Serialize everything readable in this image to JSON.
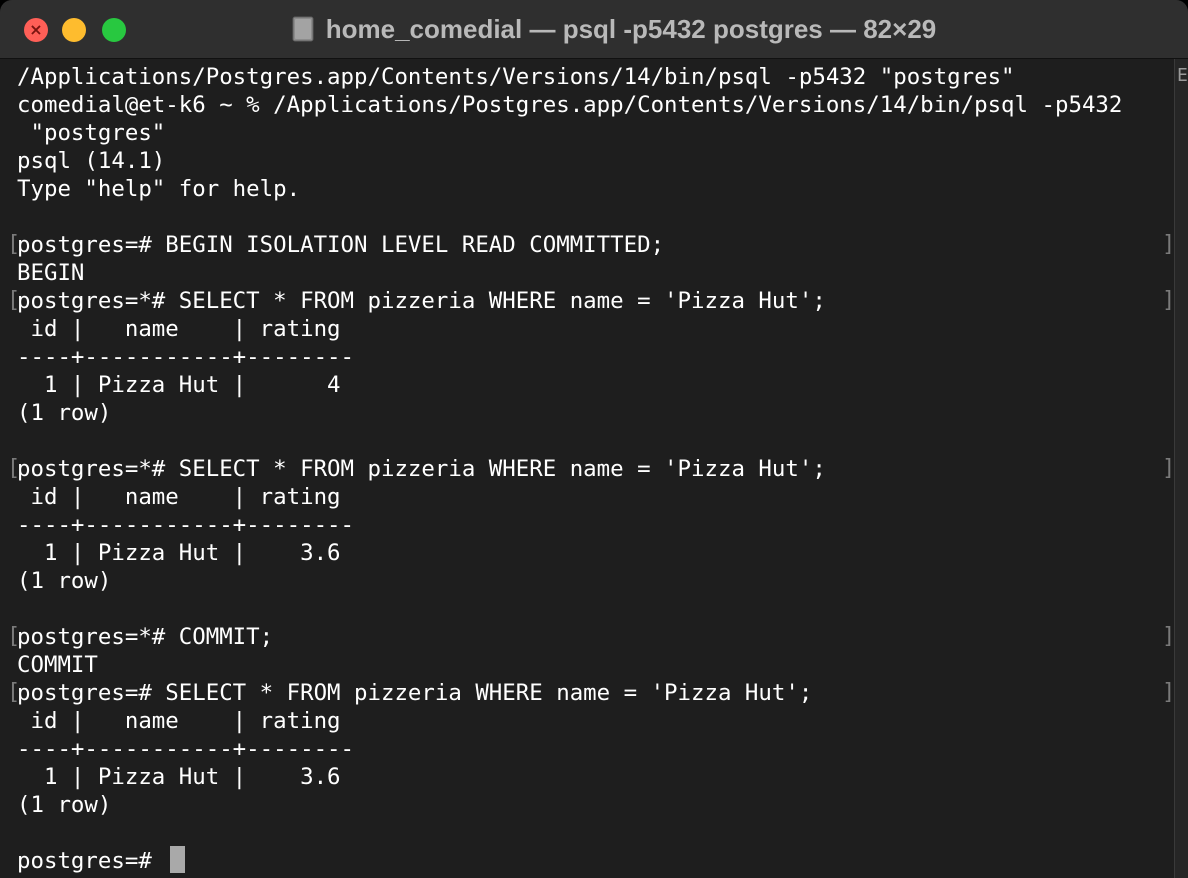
{
  "window": {
    "title": "home_comedial — psql -p5432 postgres — 82×29",
    "traffic_lights": {
      "close_color": "#ff5f57",
      "minimize_color": "#febc2e",
      "maximize_color": "#28c840",
      "close_glyph": "×"
    },
    "doc_icon": "terminal-document-icon"
  },
  "terminal": {
    "lines": [
      "/Applications/Postgres.app/Contents/Versions/14/bin/psql -p5432 \"postgres\"",
      "comedial@et-k6 ~ % /Applications/Postgres.app/Contents/Versions/14/bin/psql -p5432",
      " \"postgres\"",
      "psql (14.1)",
      "Type \"help\" for help.",
      "",
      "postgres=# BEGIN ISOLATION LEVEL READ COMMITTED;",
      "BEGIN",
      "postgres=*# SELECT * FROM pizzeria WHERE name = 'Pizza Hut';",
      " id |   name    | rating",
      "----+-----------+--------",
      "  1 | Pizza Hut |      4",
      "(1 row)",
      "",
      "postgres=*# SELECT * FROM pizzeria WHERE name = 'Pizza Hut';",
      " id |   name    | rating",
      "----+-----------+--------",
      "  1 | Pizza Hut |    3.6",
      "(1 row)",
      "",
      "postgres=*# COMMIT;",
      "COMMIT",
      "postgres=# SELECT * FROM pizzeria WHERE name = 'Pizza Hut';",
      " id |   name    | rating",
      "----+-----------+--------",
      "  1 | Pizza Hut |    3.6",
      "(1 row)",
      "",
      "postgres=# "
    ],
    "mark_left": "[",
    "mark_right": "]",
    "scroll_glyph": "E"
  }
}
